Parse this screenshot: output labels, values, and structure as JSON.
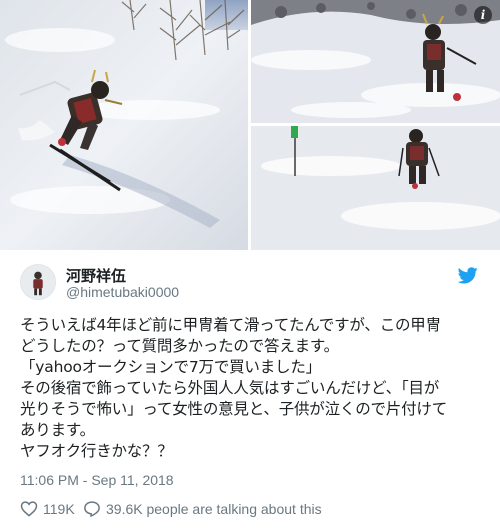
{
  "tweet": {
    "display_name": "河野祥伍",
    "handle": "@himetubaki0000",
    "text_lines": [
      "そういえば4年ほど前に甲冑着て滑ってたんですが、この甲冑",
      "どうしたの？って質問多かったので答えます。",
      "「yahooオークションで7万で買いました」",
      "その後宿で飾っていたら外国人人気はすごいんだけど、「目が",
      "光りそうで怖い」って女性の意見と、子供が泣くので片付けて",
      "あります。",
      "ヤフオク行きかな？？"
    ],
    "timestamp": "11:06 PM - Sep 11, 2018",
    "likes": "119K",
    "talking": "39.6K people are talking about this"
  },
  "media": {
    "info_label": "i",
    "icons": [
      "info-icon",
      "twitter-bird-icon",
      "heart-icon",
      "speech-bubble-icon"
    ]
  },
  "colors": {
    "text": "#1c2022",
    "muted": "#697882",
    "twitter_blue": "#1da1f2"
  }
}
